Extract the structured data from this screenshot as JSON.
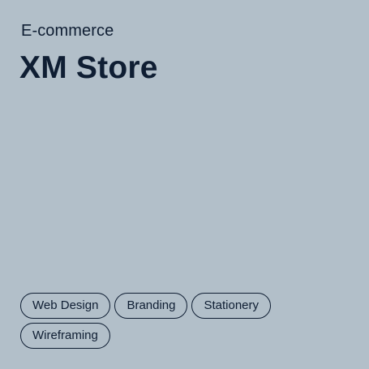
{
  "card": {
    "category": "E-commerce",
    "title": "XM Store",
    "tags": [
      "Web Design",
      "Branding",
      "Stationery",
      "Wireframing"
    ]
  },
  "colors": {
    "background": "#b2bfc9",
    "text": "#0f1e33"
  }
}
